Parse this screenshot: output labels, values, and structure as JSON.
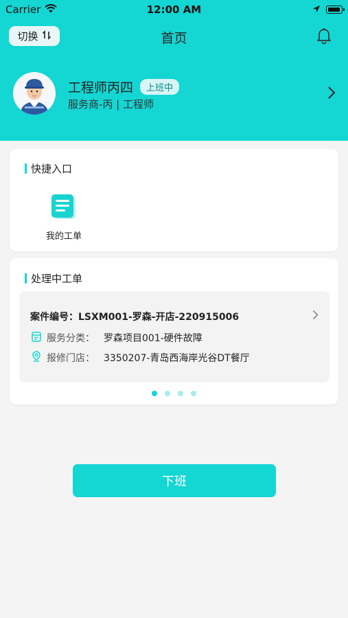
{
  "status_bar": {
    "carrier": "Carrier",
    "time": "12:00 AM"
  },
  "nav": {
    "switch_label": "切换",
    "title": "首页"
  },
  "profile": {
    "name": "工程师丙四",
    "status": "上班中",
    "role": "服务商-丙 | 工程师"
  },
  "quick_entry": {
    "title": "快捷入口",
    "items": [
      {
        "label": "我的工单",
        "icon": "document-icon"
      }
    ]
  },
  "orders": {
    "title": "处理中工单",
    "case_label": "案件编号：",
    "case_number": "LSXM001-罗森-开店-220915006",
    "category_label": "服务分类：",
    "category_value": "罗森项目001-硬件故障",
    "store_label": "报修门店：",
    "store_value": "3350207-青岛西海岸光谷DT餐厅",
    "pages": 4,
    "active_page": 1
  },
  "action": {
    "off_duty_label": "下班"
  },
  "colors": {
    "accent": "#14d6d3",
    "background": "#f4f4f4"
  }
}
